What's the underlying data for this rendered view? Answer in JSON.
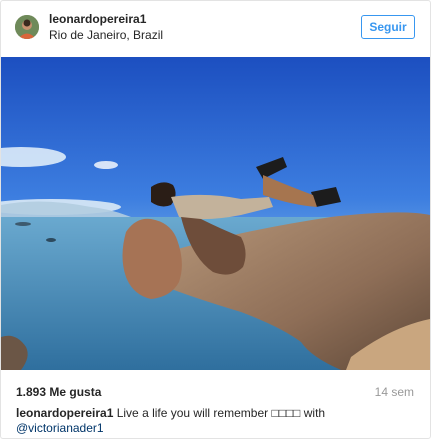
{
  "post": {
    "username": "leonardopereira1",
    "location": "Rio de Janeiro, Brazil",
    "follow_label": "Seguir",
    "likes": "1.893 Me gusta",
    "timestamp": "14 sem",
    "caption_user": "leonardopereira1",
    "caption_text": "Live a life you will remember □□□□ with",
    "caption_mention": "@victorianader1"
  },
  "colors": {
    "accent": "#3897f0",
    "mention": "#003569",
    "muted": "#999999",
    "text": "#262626",
    "sky_top": "#1e54c4",
    "sky_bottom": "#8ec3ea",
    "sea": "#5f9ec6",
    "rock": "#9a7b63"
  },
  "icons": {
    "avatar": "profile-photo"
  }
}
